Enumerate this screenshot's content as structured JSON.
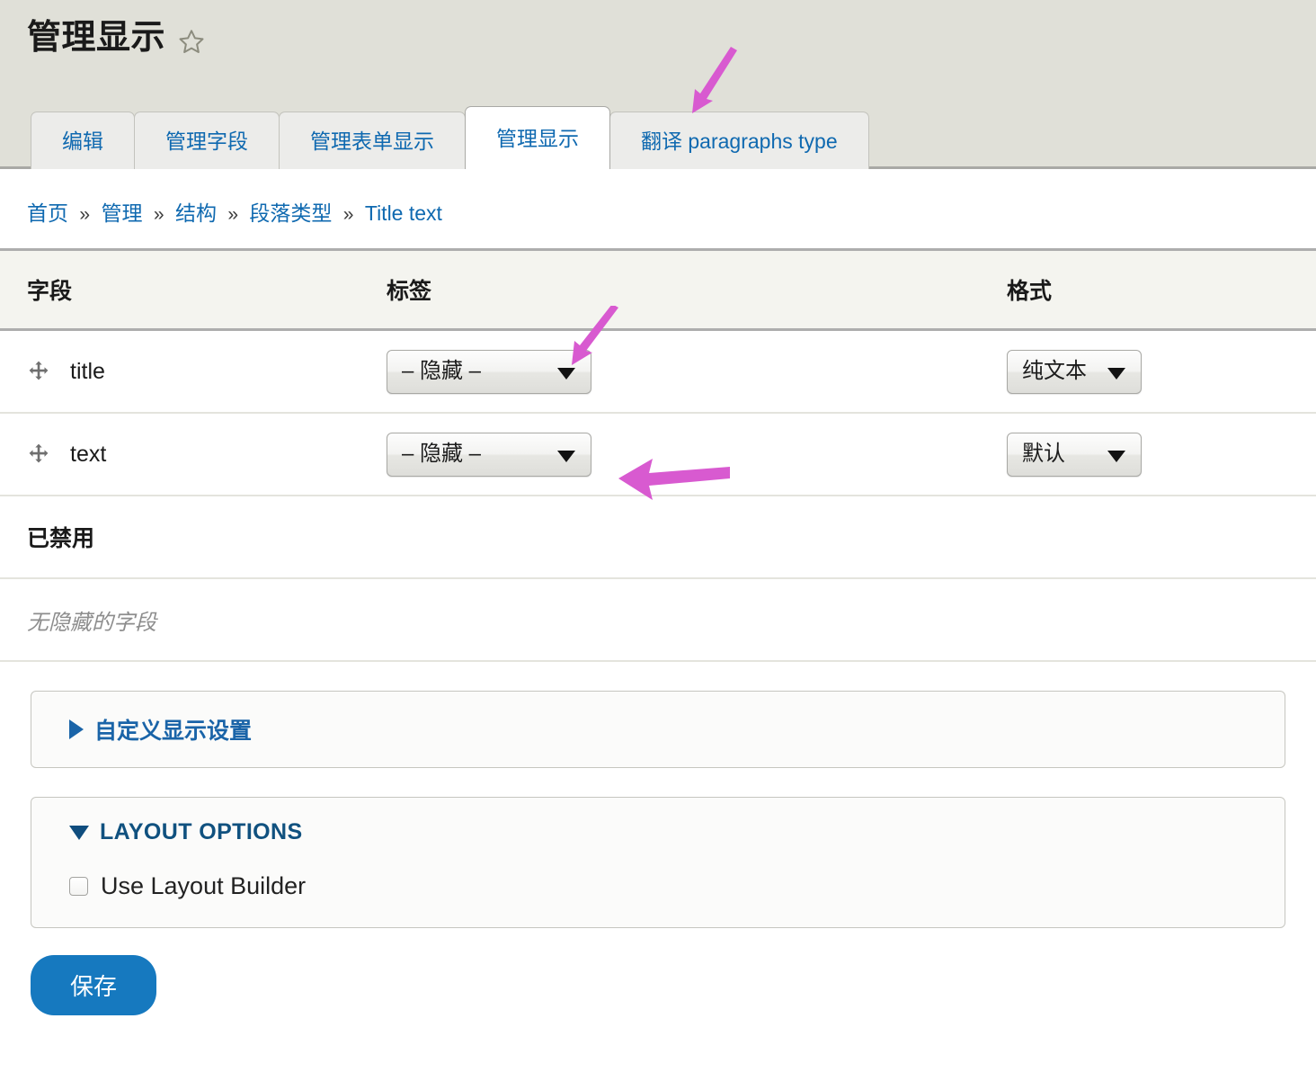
{
  "header": {
    "title": "管理显示",
    "star_icon": "star-outline-icon"
  },
  "tabs": [
    {
      "label": "编辑",
      "active": false
    },
    {
      "label": "管理字段",
      "active": false
    },
    {
      "label": "管理表单显示",
      "active": false
    },
    {
      "label": "管理显示",
      "active": true
    },
    {
      "label": "翻译 paragraphs type",
      "active": false
    }
  ],
  "breadcrumb": {
    "items": [
      "首页",
      "管理",
      "结构",
      "段落类型",
      "Title text"
    ],
    "separator": "»"
  },
  "table": {
    "headers": {
      "field": "字段",
      "label": "标签",
      "format": "格式"
    },
    "rows": [
      {
        "drag_icon": "move-cross-icon",
        "field": "title",
        "label_value": "– 隐藏 –",
        "format_value": "纯文本"
      },
      {
        "drag_icon": "move-cross-icon",
        "field": "text",
        "label_value": "– 隐藏 –",
        "format_value": "默认"
      }
    ],
    "disabled_heading": "已禁用",
    "disabled_empty": "无隐藏的字段"
  },
  "panels": {
    "custom_display": {
      "title": "自定义显示设置",
      "expanded": false,
      "marker_icon": "triangle-right-icon"
    },
    "layout_options": {
      "title": "LAYOUT OPTIONS",
      "expanded": true,
      "marker_icon": "triangle-down-icon",
      "checkbox_label": "Use Layout Builder",
      "checkbox_checked": false
    }
  },
  "actions": {
    "save_label": "保存"
  },
  "annotations": {
    "color": "#d85ad0",
    "arrows": [
      {
        "name": "arrow-to-active-tab",
        "points_at": "管理显示"
      },
      {
        "name": "arrow-to-label-column",
        "points_at": "标签"
      },
      {
        "name": "arrow-to-text-label-select",
        "points_at": "– 隐藏 –"
      }
    ]
  },
  "colors": {
    "header_bg": "#e0e0d8",
    "link": "#0f69b0",
    "primary_button": "#1679bf",
    "table_header_bg": "#f4f4ef"
  }
}
